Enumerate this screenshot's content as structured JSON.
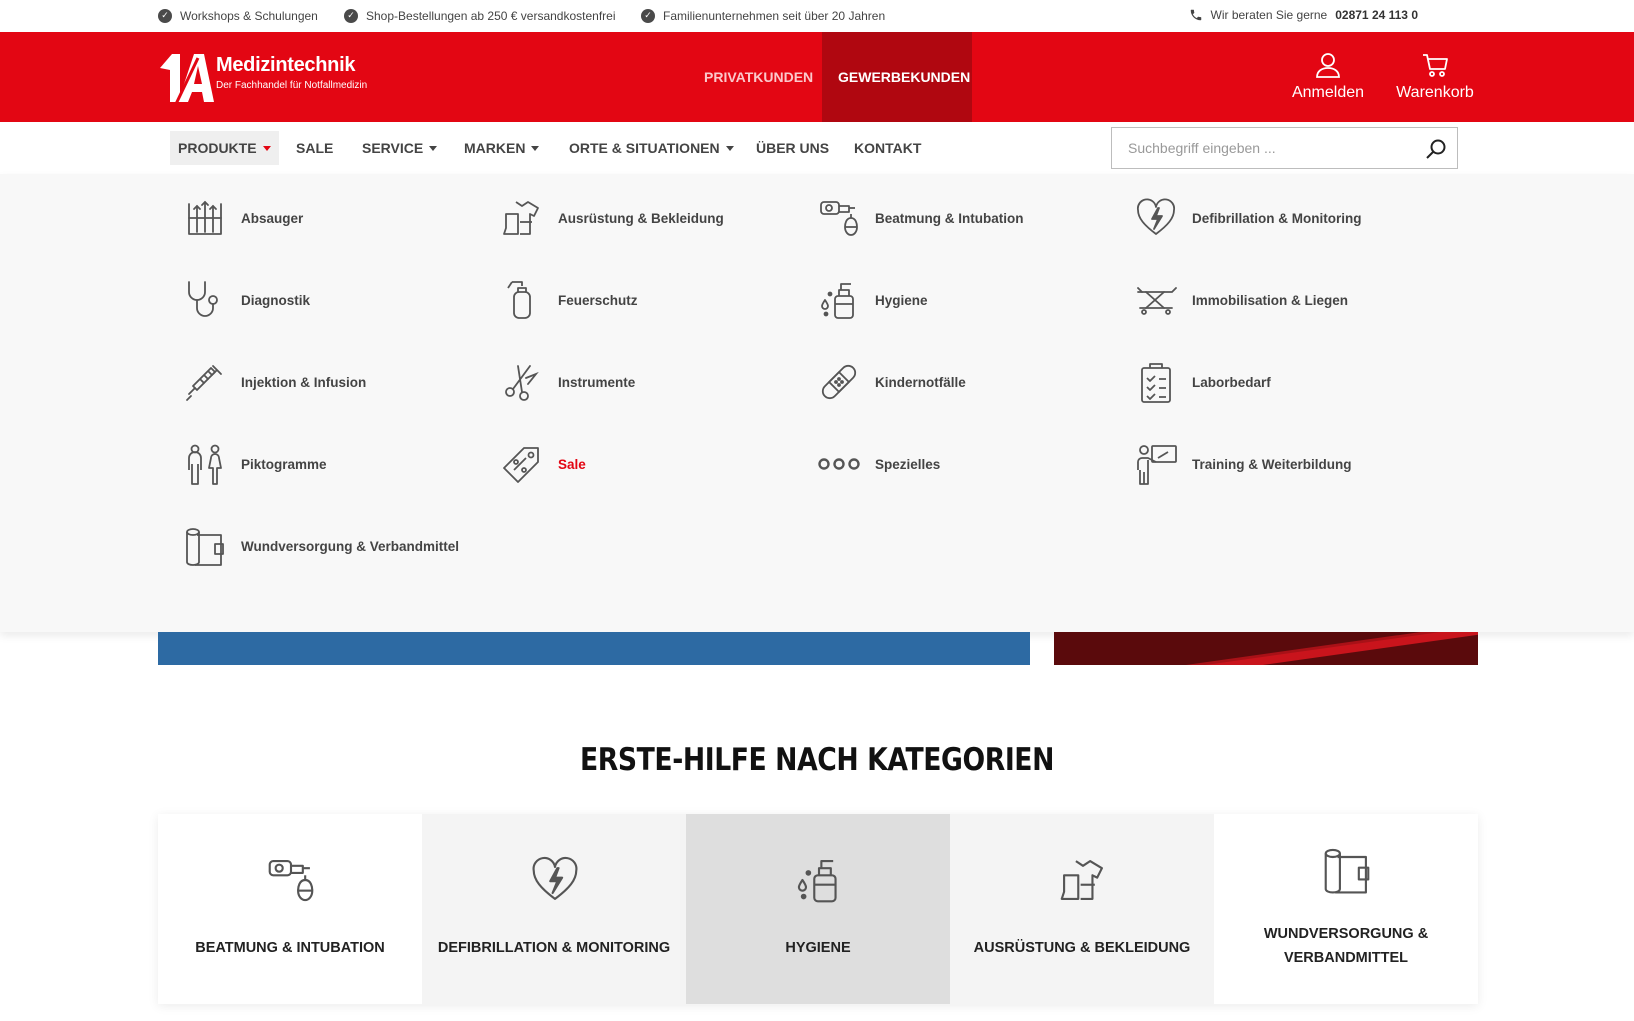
{
  "topbar": {
    "usps": [
      "Workshops & Schulungen",
      "Shop-Bestellungen ab 250 € versandkostenfrei",
      "Familienunternehmen seit über 20 Jahren"
    ],
    "hotline_text": "Wir beraten Sie gerne",
    "hotline_number": "02871 24 113 0"
  },
  "header": {
    "logo_mark": "1A",
    "brand": "Medizintechnik",
    "tagline": "Der Fachhandel für Notfallmedizin",
    "segments": [
      {
        "label": "PRIVATKUNDEN",
        "active": false
      },
      {
        "label": "GEWERBEKUNDEN",
        "active": true
      }
    ],
    "login_label": "Anmelden",
    "cart_label": "Warenkorb"
  },
  "nav": {
    "items": [
      {
        "label": "PRODUKTE",
        "dropdown": true,
        "active": true
      },
      {
        "label": "SALE",
        "dropdown": false
      },
      {
        "label": "SERVICE",
        "dropdown": true
      },
      {
        "label": "MARKEN",
        "dropdown": true
      },
      {
        "label": "ORTE & SITUATIONEN",
        "dropdown": true
      },
      {
        "label": "ÜBER UNS",
        "dropdown": false
      },
      {
        "label": "KONTAKT",
        "dropdown": false
      }
    ],
    "search_placeholder": "Suchbegriff eingeben ...",
    "search_value": ""
  },
  "dropdown": {
    "items": [
      {
        "label": "Absauger",
        "icon": "suction-icon"
      },
      {
        "label": "Ausrüstung & Bekleidung",
        "icon": "clothing-icon"
      },
      {
        "label": "Beatmung & Intubation",
        "icon": "ventilation-icon"
      },
      {
        "label": "Defibrillation & Monitoring",
        "icon": "heart-bolt-icon"
      },
      {
        "label": "Diagnostik",
        "icon": "stethoscope-icon"
      },
      {
        "label": "Feuerschutz",
        "icon": "fire-extinguisher-icon"
      },
      {
        "label": "Hygiene",
        "icon": "spray-bottle-icon"
      },
      {
        "label": "Immobilisation & Liegen",
        "icon": "stretcher-icon"
      },
      {
        "label": "Injektion & Infusion",
        "icon": "syringe-icon"
      },
      {
        "label": "Instrumente",
        "icon": "scissors-icon"
      },
      {
        "label": "Kindernotfälle",
        "icon": "bandage-icon"
      },
      {
        "label": "Laborbedarf",
        "icon": "clipboard-icon"
      },
      {
        "label": "Piktogramme",
        "icon": "people-icon"
      },
      {
        "label": "Sale",
        "icon": "price-tag-icon",
        "highlight": "#e30613"
      },
      {
        "label": "Spezielles",
        "icon": "dots-icon"
      },
      {
        "label": "Training & Weiterbildung",
        "icon": "presentation-icon"
      },
      {
        "label": "Wundversorgung & Verbandmittel",
        "icon": "bandage-roll-icon"
      }
    ]
  },
  "categories": {
    "title": "ERSTE-HILFE NACH KATEGORIEN",
    "cards": [
      {
        "label": "BEATMUNG & INTUBATION",
        "icon": "ventilation-icon",
        "bg": "#ffffff"
      },
      {
        "label": "DEFIBRILLATION & MONITORING",
        "icon": "heart-bolt-icon",
        "bg": "#f4f4f4"
      },
      {
        "label": "HYGIENE",
        "icon": "spray-bottle-icon",
        "bg": "#dedede"
      },
      {
        "label": "AUSRÜSTUNG & BEKLEIDUNG",
        "icon": "clothing-icon",
        "bg": "#f4f4f4"
      },
      {
        "label": "WUNDVERSORGUNG & VERBANDMITTEL",
        "icon": "bandage-roll-icon",
        "bg": "#ffffff"
      }
    ]
  },
  "colors": {
    "brand_red": "#e30613",
    "segment_active": "#b00710",
    "banner_blue": "#2d6aa3",
    "text_dark": "#444444"
  }
}
